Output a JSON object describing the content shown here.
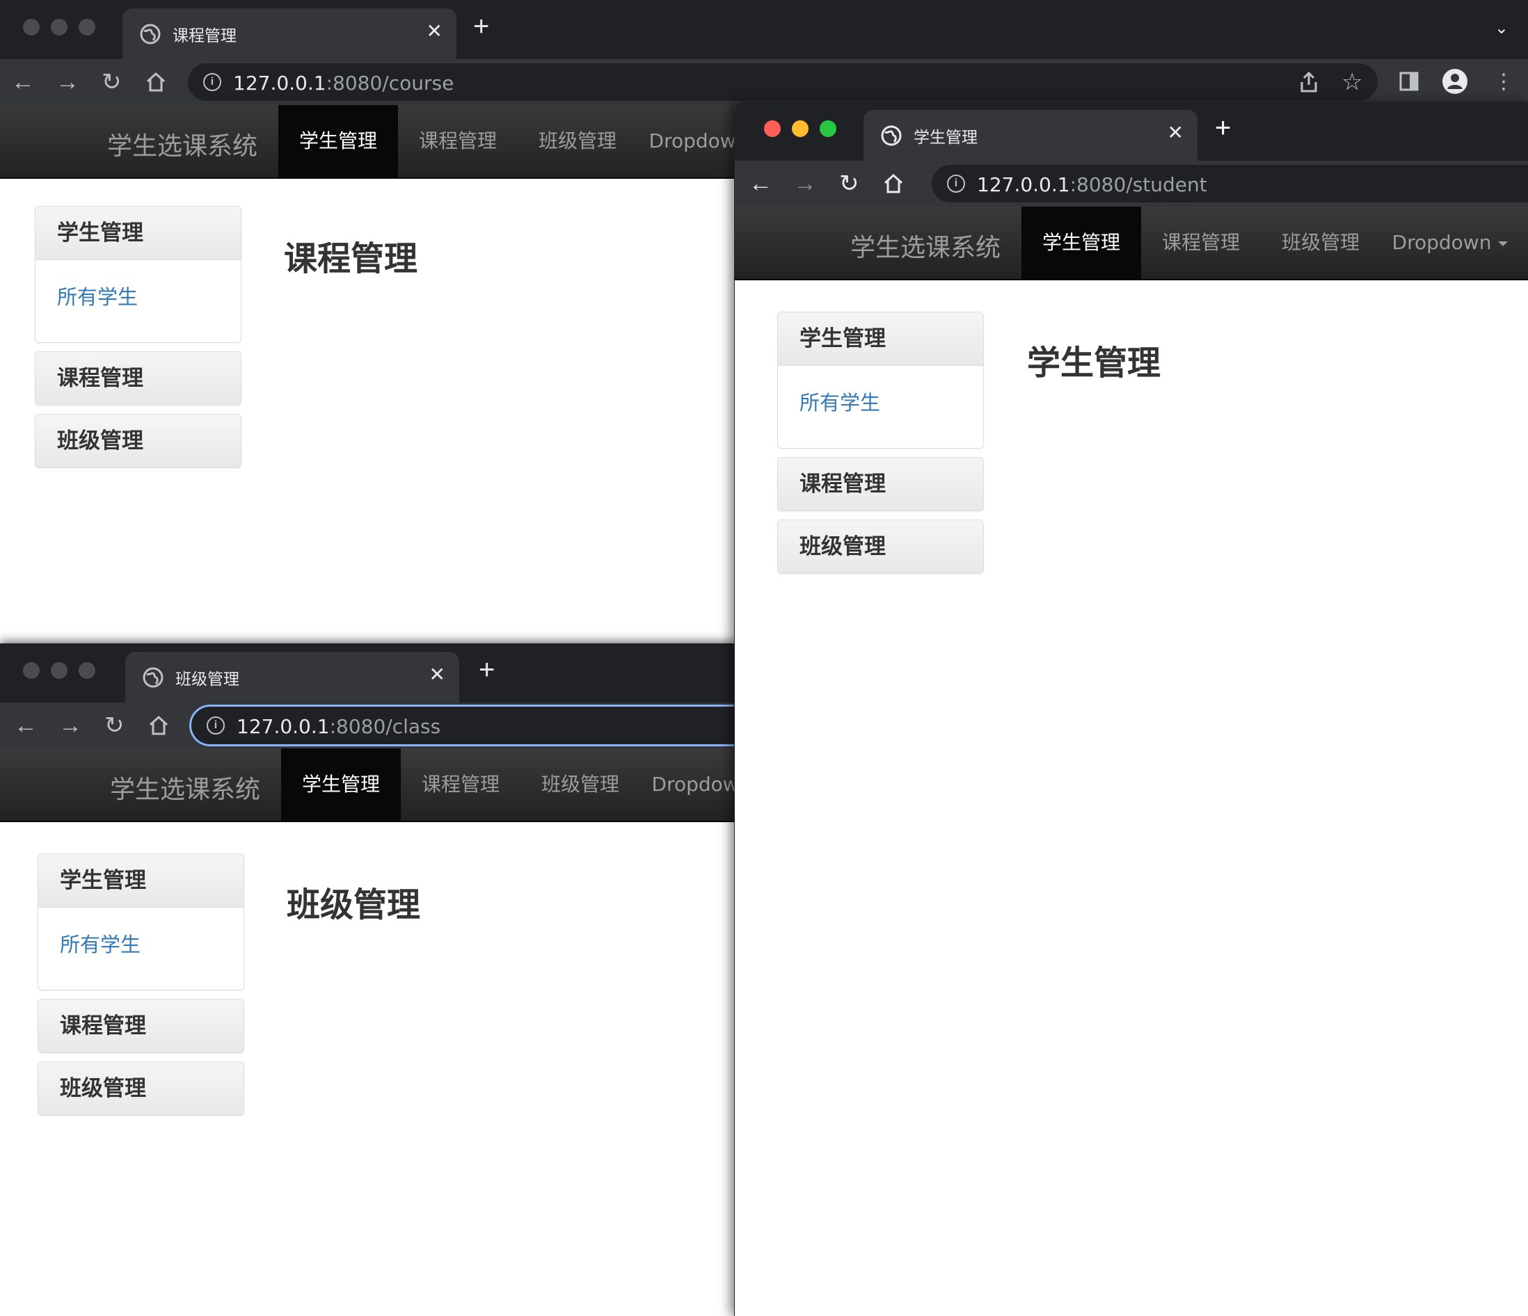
{
  "colors": {
    "chrome_dark": "#202124",
    "chrome_tab": "#35363a",
    "navbar": "#222222",
    "link": "#337ab7",
    "focus_ring": "#8ab4f8",
    "mac_close": "#ff5f57",
    "mac_min": "#febc2e",
    "mac_max": "#28c840"
  },
  "windows": {
    "course": {
      "tab_title": "课程管理",
      "url_host": "127.0.0.1",
      "url_rest": ":8080/course",
      "brand": "学生选课系统",
      "nav": [
        "学生管理",
        "课程管理",
        "班级管理",
        "Dropdown"
      ],
      "sidebar": {
        "student": "学生管理",
        "all_students": "所有学生",
        "course": "课程管理",
        "class": "班级管理"
      },
      "heading": "课程管理"
    },
    "student": {
      "tab_title": "学生管理",
      "url_host": "127.0.0.1",
      "url_rest": ":8080/student",
      "brand": "学生选课系统",
      "nav": [
        "学生管理",
        "课程管理",
        "班级管理",
        "Dropdown"
      ],
      "sidebar": {
        "student": "学生管理",
        "all_students": "所有学生",
        "course": "课程管理",
        "class": "班级管理"
      },
      "heading": "学生管理"
    },
    "class": {
      "tab_title": "班级管理",
      "url_host": "127.0.0.1",
      "url_rest": ":8080/class",
      "brand": "学生选课系统",
      "nav": [
        "学生管理",
        "课程管理",
        "班级管理",
        "Dropdown"
      ],
      "sidebar": {
        "student": "学生管理",
        "all_students": "所有学生",
        "course": "课程管理",
        "class": "班级管理"
      },
      "heading": "班级管理"
    }
  },
  "icons": [
    "globe-icon",
    "close-icon",
    "new-tab-icon",
    "back-icon",
    "forward-icon",
    "reload-icon",
    "home-icon",
    "info-icon",
    "share-icon",
    "star-icon",
    "sidepanel-icon",
    "profile-icon",
    "menu-icon",
    "chevron-down-icon",
    "caret-down-icon"
  ]
}
